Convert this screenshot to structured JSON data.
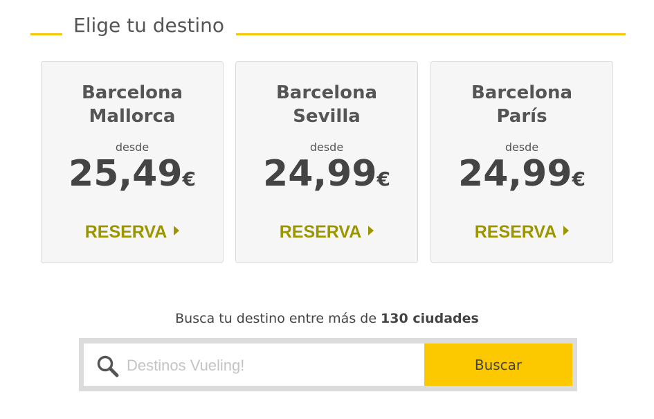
{
  "header": {
    "title": "Elige tu destino"
  },
  "cards": [
    {
      "origin": "Barcelona",
      "destination": "Mallorca",
      "from_label": "desde",
      "price": "25,49",
      "currency": "€",
      "cta": "RESERVA"
    },
    {
      "origin": "Barcelona",
      "destination": "Sevilla",
      "from_label": "desde",
      "price": "24,99",
      "currency": "€",
      "cta": "RESERVA"
    },
    {
      "origin": "Barcelona",
      "destination": "París",
      "from_label": "desde",
      "price": "24,99",
      "currency": "€",
      "cta": "RESERVA"
    }
  ],
  "search": {
    "prompt_text": "Busca tu destino entre más de ",
    "prompt_bold": "130 ciudades",
    "placeholder": "Destinos Vueling!",
    "value": "",
    "button_label": "Buscar"
  },
  "colors": {
    "accent_yellow": "#fcc800",
    "cta_olive": "#9b9500"
  },
  "icons": [
    "search-icon",
    "triangle-right-icon"
  ]
}
